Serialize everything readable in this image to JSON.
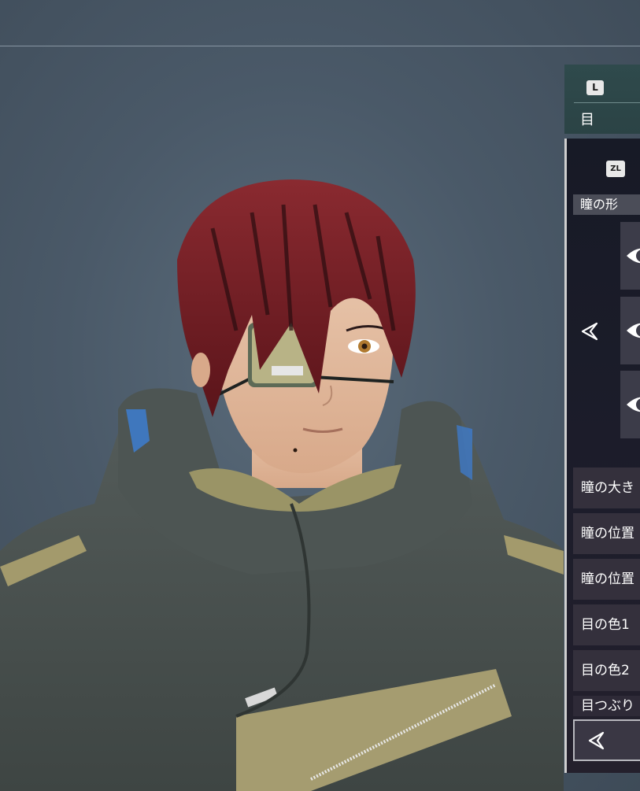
{
  "header": {
    "key_hint": "L",
    "title": "目"
  },
  "panel": {
    "key_hint": "ZL",
    "section_label": "瞳の形",
    "shape_options": [
      "pupil-shape-1",
      "pupil-shape-2",
      "pupil-shape-3"
    ],
    "settings": [
      {
        "label": "瞳の大き"
      },
      {
        "label": "瞳の位置"
      },
      {
        "label": "瞳の位置"
      },
      {
        "label": "目の色1"
      },
      {
        "label": "目の色2"
      },
      {
        "label": "目つぶり"
      }
    ]
  },
  "icons": {
    "prev_arrow": "chevron-left-icon",
    "back_arrow": "chevron-left-icon"
  },
  "colors": {
    "background": "#4a5968",
    "header_bg": "#2f4a4c",
    "panel_bg": "#1d1d2b",
    "row_bg": "#34303c",
    "hair": "#6e1a22",
    "jacket": "#4a5250"
  }
}
